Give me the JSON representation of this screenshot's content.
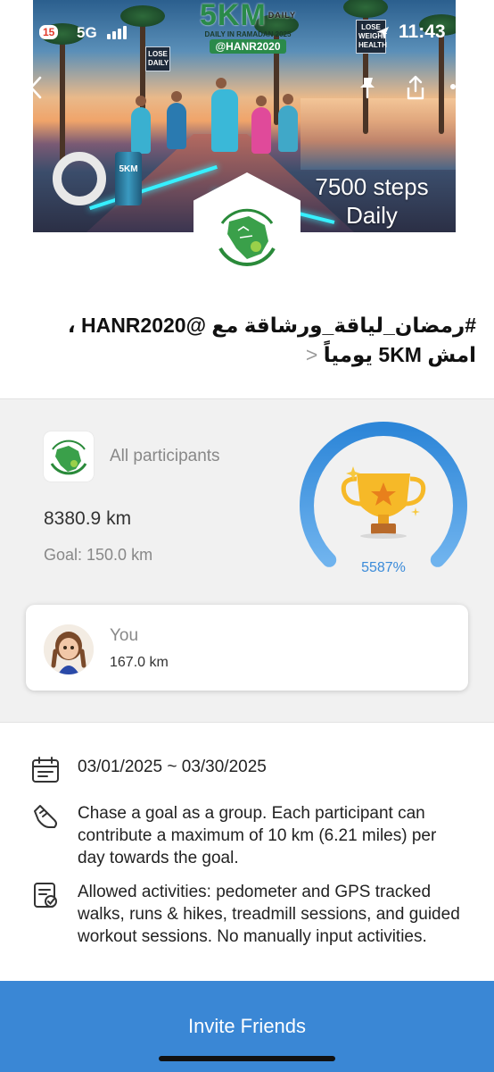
{
  "status_bar": {
    "time": "11:43",
    "network": "5G",
    "badge": "15"
  },
  "banner": {
    "brand_title": "5KM",
    "brand_daily": "DAILY",
    "brand_sub": "DAILY IN RAMADAN 2025",
    "brand_handle": "@HANR2020",
    "steps_text": "7500 steps Daily",
    "sign_left": "LOSE DAILY",
    "sign_right": "LOSE WEIGHT HEALTH",
    "can_text": "5KM"
  },
  "nav": {
    "back_icon": "chevron-left-icon",
    "pin_icon": "pin-icon",
    "share_icon": "share-icon",
    "more_icon": "more-icon"
  },
  "challenge": {
    "title": "#رمضان_لياقة_ورشاقة مع @HANR2020 ، امش 5KM يومياً",
    "chevron": "<"
  },
  "progress": {
    "participants_label": "All participants",
    "distance": "8380.9 km",
    "goal": "Goal: 150.0 km",
    "percent_text": "5587%",
    "ring_fraction": 1.0,
    "accent": "#3b8bd9"
  },
  "you": {
    "label": "You",
    "distance": "167.0 km"
  },
  "info": {
    "dates": "03/01/2025 ~ 03/30/2025",
    "description": "Chase a goal as a group. Each participant can contribute a maximum of 10 km (6.21 miles) per day towards the goal.",
    "activities": "Allowed activities: pedometer and GPS tracked walks, runs & hikes, treadmill sessions, and guided workout sessions. No manually input activities."
  },
  "cta": {
    "invite_label": "Invite Friends",
    "color": "#3a87d5"
  }
}
